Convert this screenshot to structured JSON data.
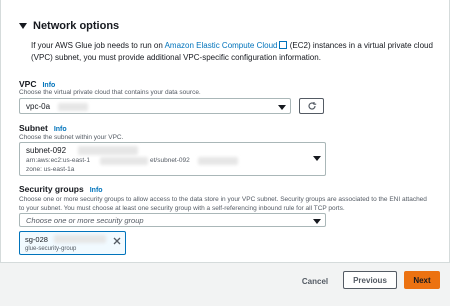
{
  "section": {
    "title": "Network options",
    "desc_part1": "If your AWS Glue job needs to run on",
    "desc_link": "Amazon Elastic Compute Cloud",
    "desc_part2": "(EC2) instances in a virtual private cloud (VPC) subnet, you must provide additional VPC-specific configuration information."
  },
  "vpc": {
    "label": "VPC",
    "info": "Info",
    "hint": "Choose the virtual private cloud that contains your data source.",
    "value": "vpc-0a"
  },
  "subnet": {
    "label": "Subnet",
    "info": "Info",
    "hint": "Choose the subnet within your VPC.",
    "value": "subnet-092",
    "arn_prefix": "arn:aws:ec2:us-east-1",
    "arn_mid": "et/subnet-092",
    "zone": "zone: us-east-1a"
  },
  "security_groups": {
    "label": "Security groups",
    "info": "Info",
    "hint_line1": "Choose one or more security groups to allow access to the data store in your VPC subnet. Security groups are associated to the ENI attached",
    "hint_line2": "to your subnet. You must choose at least one security group with a self-referencing inbound rule for all TCP ports.",
    "placeholder": "Choose one or more security group",
    "token_id": "sg-028",
    "token_name": "glue-security-group"
  },
  "footer": {
    "cancel": "Cancel",
    "previous": "Previous",
    "next": "Next"
  },
  "colors": {
    "primary": "#ec7211",
    "link": "#0073bb"
  }
}
